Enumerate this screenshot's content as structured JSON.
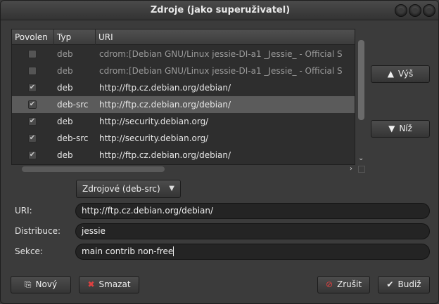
{
  "window": {
    "title": "Zdroje (jako superuživatel)"
  },
  "table": {
    "columns": [
      "Povolen",
      "Typ",
      "URI"
    ],
    "rows": [
      {
        "enabled": false,
        "type": "deb",
        "uri": "cdrom:[Debian GNU/Linux jessie-DI-a1 _Jessie_ - Official S",
        "dim": true
      },
      {
        "enabled": false,
        "type": "deb",
        "uri": "cdrom:[Debian GNU/Linux jessie-DI-a1 _Jessie_ - Official S",
        "dim": true
      },
      {
        "enabled": true,
        "type": "deb",
        "uri": "http://ftp.cz.debian.org/debian/"
      },
      {
        "enabled": true,
        "type": "deb-src",
        "uri": "http://ftp.cz.debian.org/debian/",
        "selected": true
      },
      {
        "enabled": true,
        "type": "deb",
        "uri": "http://security.debian.org/"
      },
      {
        "enabled": true,
        "type": "deb-src",
        "uri": "http://security.debian.org/"
      },
      {
        "enabled": true,
        "type": "deb",
        "uri": "http://ftp.cz.debian.org/debian/"
      }
    ]
  },
  "side_buttons": {
    "up": "Výš",
    "down": "Níž"
  },
  "type_combo": {
    "value": "Zdrojové (deb-src)"
  },
  "form": {
    "uri_label": "URI:",
    "uri_value": "http://ftp.cz.debian.org/debian/",
    "dist_label": "Distribuce:",
    "dist_value": "jessie",
    "sect_label": "Sekce:",
    "sect_value": "main contrib non-free"
  },
  "bottom_buttons": {
    "new": "Nový",
    "delete": "Smazat",
    "cancel": "Zrušit",
    "ok": "Budiž"
  }
}
